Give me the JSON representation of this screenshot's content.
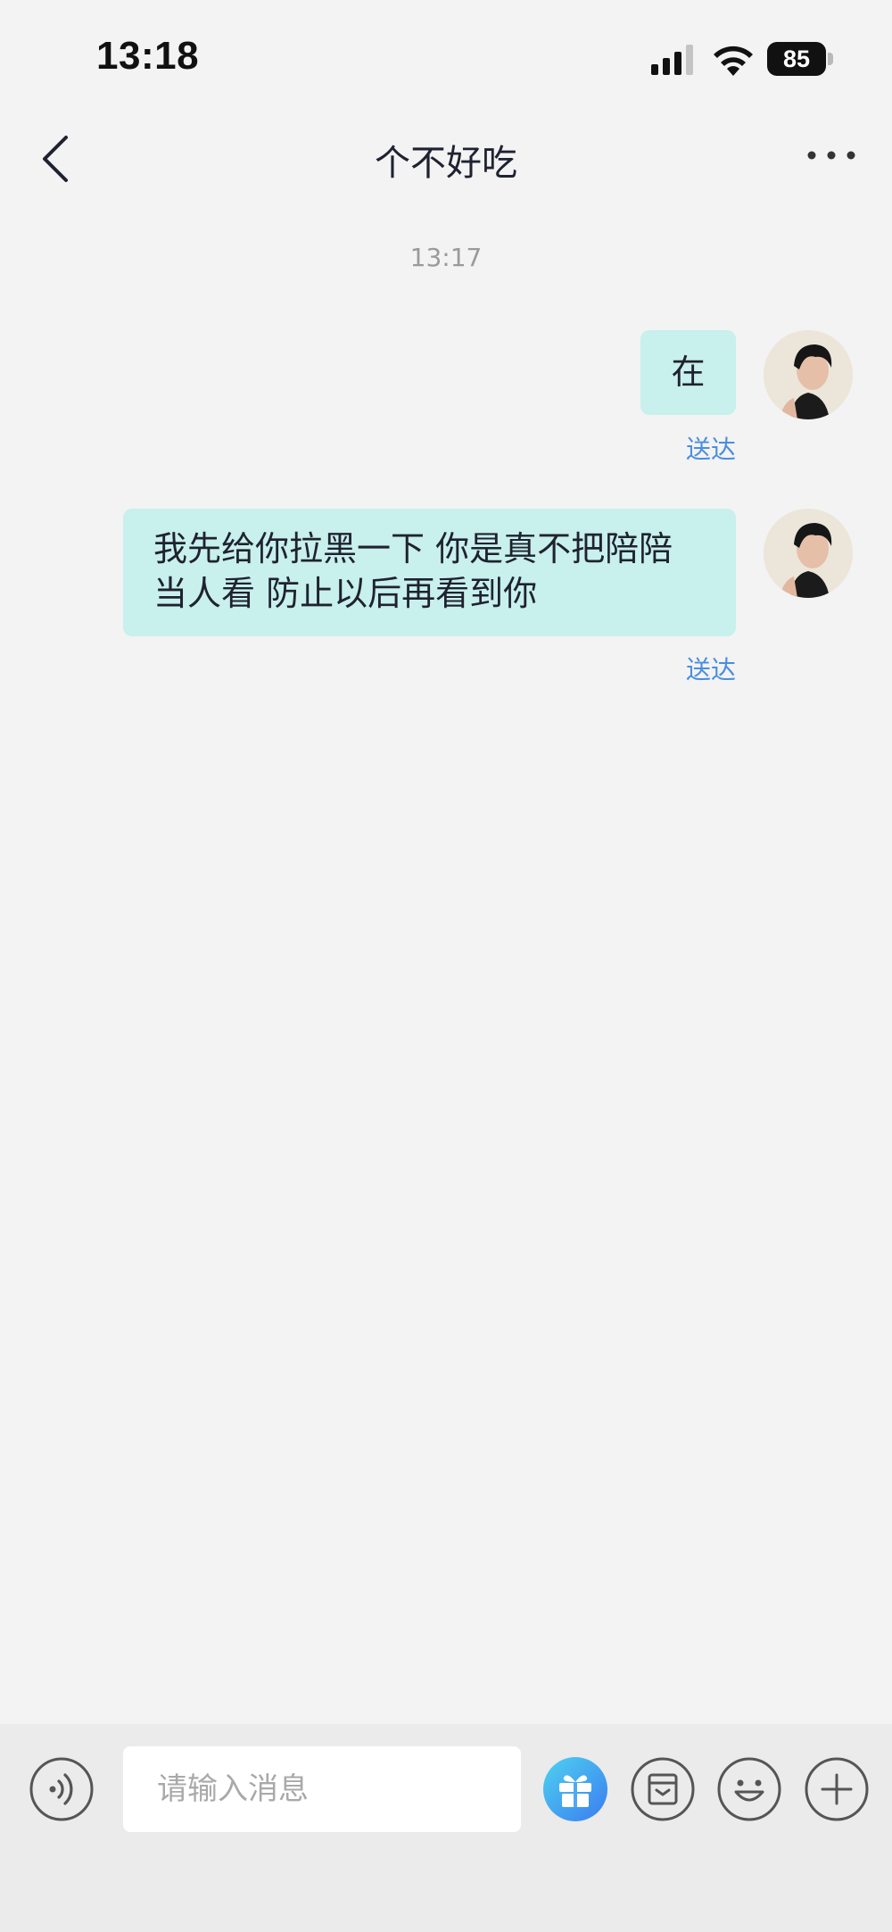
{
  "status_bar": {
    "time": "13:18",
    "battery": "85"
  },
  "header": {
    "title": "个不好吃",
    "back_icon": "chevron-left-icon",
    "more_icon": "ellipsis-icon"
  },
  "chat": {
    "timestamp": "13:17",
    "messages": [
      {
        "text": "在",
        "status": "送达",
        "sender": "self"
      },
      {
        "text": "我先给你拉黑一下 你是真不把陪陪当人看 防止以后再看到你",
        "status": "送达",
        "sender": "self"
      }
    ]
  },
  "input_bar": {
    "placeholder": "请输入消息",
    "icons": [
      "voice-icon",
      "gift-icon",
      "album-icon",
      "emoji-icon",
      "plus-icon"
    ]
  },
  "colors": {
    "background": "#f3f3f3",
    "bubble": "#c8f0ec",
    "delivered": "#4a8de0",
    "gift_gradient_start": "#4fd2f0",
    "gift_gradient_end": "#3a7cf0"
  }
}
